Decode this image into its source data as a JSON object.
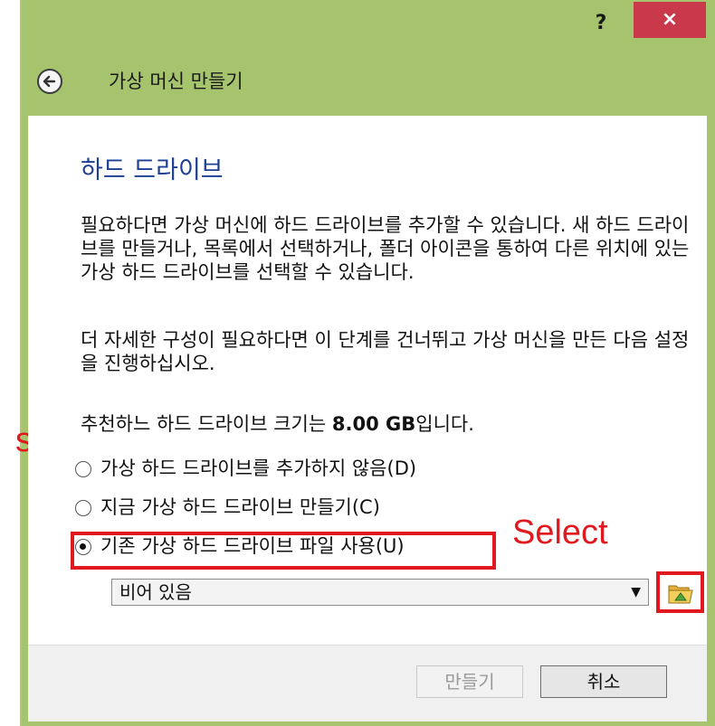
{
  "window": {
    "help_label": "?",
    "close_label": "×",
    "title": "가상 머신 만들기"
  },
  "page": {
    "title": "하드 드라이브",
    "paragraph1": "필요하다면 가상 머신에 하드 드라이브를 추가할 수 있습니다. 새 하드 드라이브를 만들거나, 목록에서 선택하거나, 폴더 아이콘을 통하여 다른 위치에 있는 가상 하드 드라이브를 선택할 수 있습니다.",
    "paragraph2": "더 자세한 구성이 필요하다면 이 단계를 건너뛰고 가상 머신을 만든 다음 설정을 진행하십시오.",
    "recommend_prefix": "추천하느 하드 드라이브 크기는 ",
    "recommend_size": "8.00 GB",
    "recommend_suffix": "입니다."
  },
  "options": [
    {
      "label": "가상 하드 드라이브를 추가하지 않음(D)",
      "selected": false
    },
    {
      "label": "지금 가상 하드 드라이브 만들기(C)",
      "selected": false
    },
    {
      "label": "기존 가상 하드 드라이브 파일 사용(U)",
      "selected": true
    }
  ],
  "file_select": {
    "value": "비어 있음",
    "arrow": "▼"
  },
  "annotations": {
    "select_label": "Select",
    "side_label": "se"
  },
  "footer": {
    "create_label": "만들기",
    "cancel_label": "취소"
  },
  "colors": {
    "accent_green": "#a6c36e",
    "title_blue": "#1c3f93",
    "annotation_red": "#e1181e",
    "close_red": "#c9394b"
  }
}
